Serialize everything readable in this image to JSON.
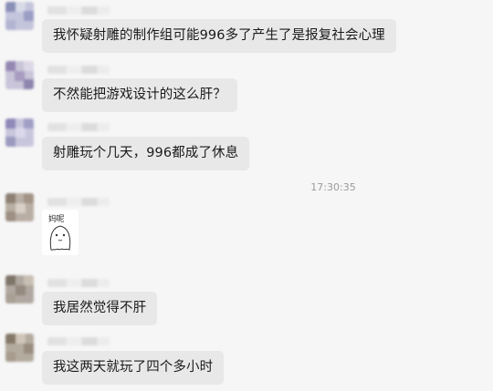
{
  "chat": {
    "timestamp": "17:30:35",
    "messages": [
      {
        "text": "我怀疑射雕的制作组可能996多了产生了是报复社会心理"
      },
      {
        "text": "不然能把游戏设计的这么肝？"
      },
      {
        "text": "射雕玩个几天，996都成了休息"
      },
      {
        "sticker_caption": "妈呢"
      },
      {
        "text": "我居然觉得不肝"
      },
      {
        "text": "我这两天就玩了四个多小时"
      }
    ]
  }
}
